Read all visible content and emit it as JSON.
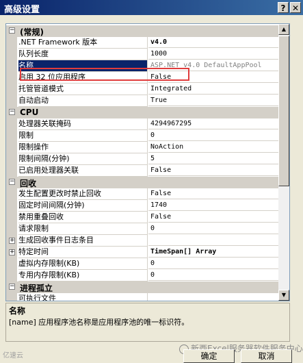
{
  "window": {
    "title": "高级设置",
    "help_glyph": "?",
    "close_glyph": "✕"
  },
  "grid": {
    "categories": {
      "general": {
        "label": "(常规)",
        "toggle": "⊟"
      },
      "cpu": {
        "label": "CPU",
        "toggle": "⊟"
      },
      "recycle": {
        "label": "回收",
        "toggle": "⊟"
      },
      "isolation": {
        "label": "进程孤立",
        "toggle": "⊟"
      }
    },
    "general_props": [
      {
        "name": ".NET Framework 版本",
        "value": "v4.0"
      },
      {
        "name": "队列长度",
        "value": "1000"
      },
      {
        "name": "名称",
        "value": "ASP.NET v4.0 DefaultAppPool"
      },
      {
        "name": "启用 32 位应用程序",
        "value": "False"
      },
      {
        "name": "托管管道模式",
        "value": "Integrated"
      },
      {
        "name": "自动启动",
        "value": "True"
      }
    ],
    "cpu_props": [
      {
        "name": "处理器关联掩码",
        "value": "4294967295"
      },
      {
        "name": "限制",
        "value": "0"
      },
      {
        "name": "限制操作",
        "value": "NoAction"
      },
      {
        "name": "限制间隔(分钟)",
        "value": "5"
      },
      {
        "name": "已启用处理器关联",
        "value": "False"
      }
    ],
    "recycle_props": [
      {
        "name": "发生配置更改时禁止回收",
        "value": "False"
      },
      {
        "name": "固定时间间隔(分钟)",
        "value": "1740"
      },
      {
        "name": "禁用重叠回收",
        "value": "False"
      },
      {
        "name": "请求限制",
        "value": "0"
      },
      {
        "name": "生成回收事件日志条目",
        "value": "",
        "expander": "⊞"
      },
      {
        "name": "特定时间",
        "value": "TimeSpan[] Array",
        "expander": "⊞"
      },
      {
        "name": "虚拟内存限制(KB)",
        "value": "0"
      },
      {
        "name": "专用内存限制(KB)",
        "value": "0"
      }
    ],
    "isolation_props": [
      {
        "name": "可执行文件",
        "value": ""
      }
    ],
    "scroll_up": "▲",
    "scroll_down": "▼"
  },
  "description": {
    "title": "名称",
    "text": "[name] 应用程序池名称是应用程序池的唯一标识符。"
  },
  "buttons": {
    "ok": "确定",
    "cancel": "取消"
  },
  "watermarks": {
    "left": "亿速云",
    "right": "新西Excel服务器软件服务中心"
  }
}
